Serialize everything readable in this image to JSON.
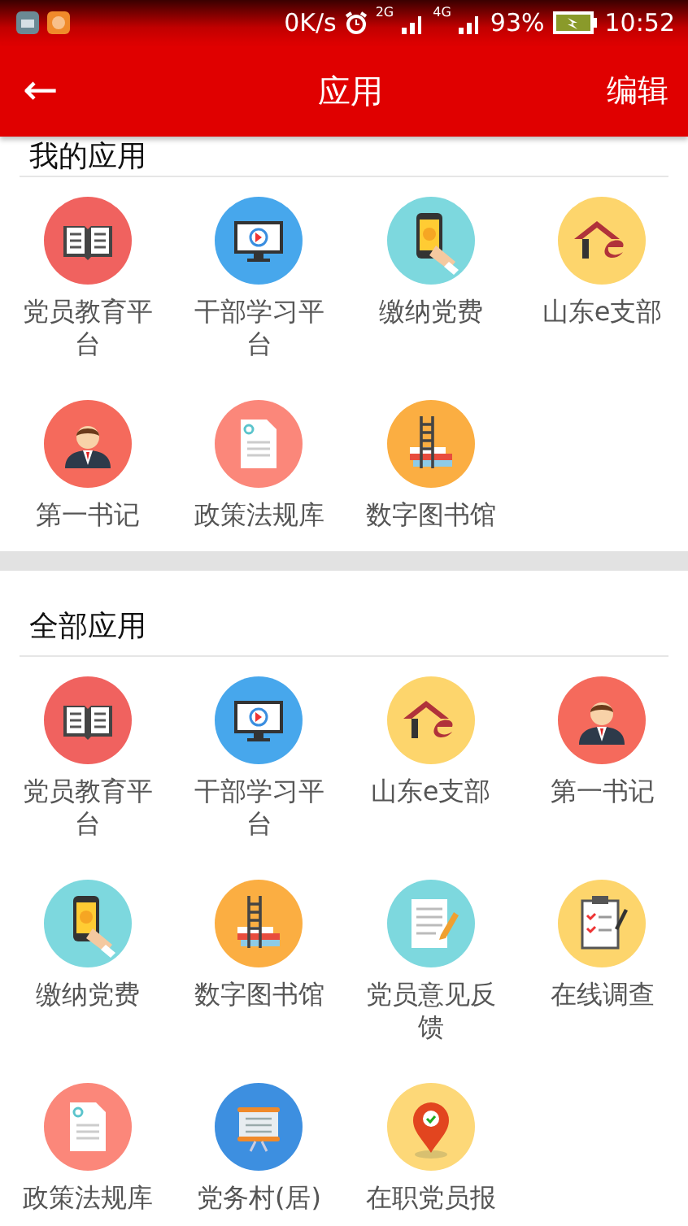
{
  "status_bar": {
    "speed": "0K/s",
    "network_1": "2G",
    "network_2": "4G",
    "battery": "93%",
    "time": "10:52"
  },
  "app_bar": {
    "back": "←",
    "title": "应用",
    "action": "编辑"
  },
  "sections": [
    {
      "title": "我的应用",
      "apps": [
        {
          "label": "党员教育平台",
          "kind": "book"
        },
        {
          "label": "干部学习平台",
          "kind": "monitor"
        },
        {
          "label": "缴纳党费",
          "kind": "phone"
        },
        {
          "label": "山东e支部",
          "kind": "house"
        },
        {
          "label": "第一书记",
          "kind": "person"
        },
        {
          "label": "政策法规库",
          "kind": "document"
        },
        {
          "label": "数字图书馆",
          "kind": "ladder"
        }
      ]
    },
    {
      "title": "全部应用",
      "apps": [
        {
          "label": "党员教育平台",
          "kind": "book"
        },
        {
          "label": "干部学习平台",
          "kind": "monitor"
        },
        {
          "label": "山东e支部",
          "kind": "house"
        },
        {
          "label": "第一书记",
          "kind": "person"
        },
        {
          "label": "缴纳党费",
          "kind": "phone"
        },
        {
          "label": "数字图书馆",
          "kind": "ladder"
        },
        {
          "label": "党员意见反馈",
          "kind": "notepad"
        },
        {
          "label": "在线调查",
          "kind": "clipboard"
        },
        {
          "label": "政策法规库",
          "kind": "document"
        },
        {
          "label": "党务村(居)",
          "kind": "board"
        },
        {
          "label": "在职党员报",
          "kind": "pin"
        }
      ]
    }
  ]
}
